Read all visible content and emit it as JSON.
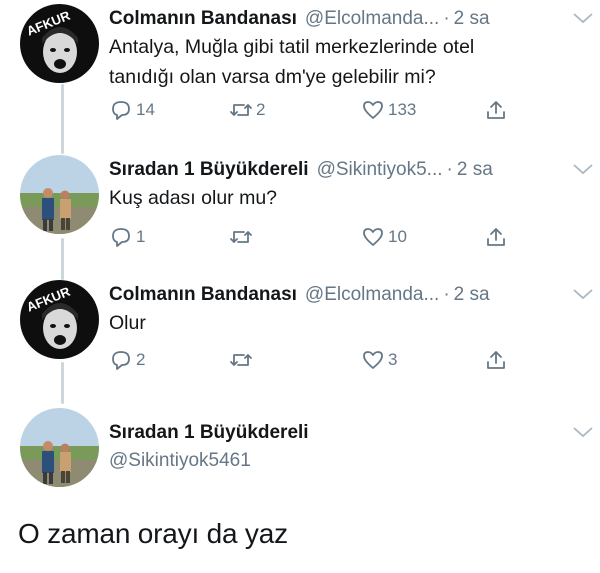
{
  "tweets": [
    {
      "name": "Colmanın Bandanası",
      "handle": "@Elcolmanda...",
      "time": "2 sa",
      "text_lines": [
        "Antalya, Muğla gibi tatil merkezlerinde otel",
        "tanıdığı olan varsa dm'ye gelebilir mi?"
      ],
      "replies": "14",
      "retweets": "2",
      "likes": "133",
      "avatar_text": "AFKUR"
    },
    {
      "name": "Sıradan 1 Büyükdereli",
      "handle": "@Sikintiyok5...",
      "time": "2 sa",
      "text_lines": [
        "Kuş adası olur mu?"
      ],
      "replies": "1",
      "retweets": "",
      "likes": "10"
    },
    {
      "name": "Colmanın Bandanası",
      "handle": "@Elcolmanda...",
      "time": "2 sa",
      "text_lines": [
        "Olur"
      ],
      "replies": "2",
      "retweets": "",
      "likes": "3",
      "avatar_text": "AFKUR"
    },
    {
      "name": "Sıradan 1 Büyükdereli",
      "handle": "@Sikintiyok5461"
    }
  ],
  "separator": "·",
  "caption": "O zaman orayı da yaz",
  "icons": {
    "reply": "reply-icon",
    "retweet": "retweet-icon",
    "like": "heart-icon",
    "share": "share-icon",
    "caret": "chevron-down-icon"
  },
  "colors": {
    "text": "#14171a",
    "secondary": "#657786",
    "thread_line": "#ccd6dd"
  }
}
